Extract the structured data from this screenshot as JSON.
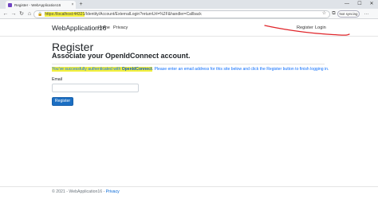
{
  "browser": {
    "tab_title": "Register - WebApplication16",
    "tab_close": "×",
    "new_tab": "+",
    "url_highlighted": "https://localhost:44321",
    "url_rest": "/Identity/Account/ExternalLogin?returnUrl=%2F&handler=Callback",
    "sync_label": "Not syncing",
    "controls": {
      "minimize": "—",
      "maximize": "☐",
      "close": "✕"
    },
    "nav": {
      "back": "←",
      "forward": "→",
      "refresh": "↻",
      "home": "⌂"
    },
    "icons": {
      "lock": "🔒",
      "favorites": "☆",
      "collections": "⧉",
      "more": "…"
    }
  },
  "site": {
    "brand": "WebApplication16",
    "nav_links": [
      "Home",
      "Privacy"
    ],
    "auth_links": [
      "Register",
      "Login"
    ]
  },
  "main": {
    "title": "Register",
    "subtitle": "Associate your OpenIdConnect account.",
    "info_prefix": "You've successfully authenticated with ",
    "info_provider": "OpenIdConnect",
    "info_suffix": ". Please enter an email address for this site below and click the Register button to finish logging in.",
    "email_label": "Email",
    "email_value": "",
    "register_button": "Register"
  },
  "footer": {
    "text": "© 2021 - WebApplication16 - ",
    "privacy_link": "Privacy"
  },
  "colors": {
    "highlight": "#f3f03d",
    "annotation_pen": "#e0262b",
    "button_primary": "#1b6ec2",
    "info_text": "#0d6efd"
  }
}
